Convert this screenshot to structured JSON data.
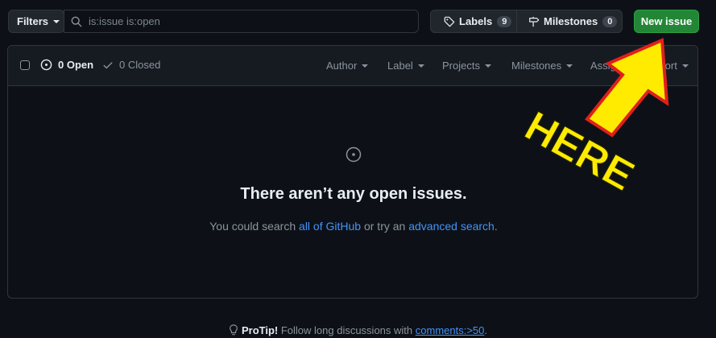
{
  "toolbar": {
    "filters_label": "Filters",
    "search_value": "is:issue is:open",
    "labels_label": "Labels",
    "labels_count": "9",
    "milestones_label": "Milestones",
    "milestones_count": "0",
    "new_issue_label": "New issue"
  },
  "list_header": {
    "open_label": "0 Open",
    "closed_label": "0 Closed",
    "filters": [
      "Author",
      "Label",
      "Projects",
      "Milestones",
      "Assignee",
      "Sort"
    ]
  },
  "empty_state": {
    "title": "There aren’t any open issues.",
    "desc_prefix": "You could search ",
    "link_all": "all of GitHub",
    "desc_middle": " or try an ",
    "link_advanced": "advanced search",
    "desc_suffix": "."
  },
  "protip": {
    "label": "ProTip!",
    "text": " Follow long discussions with ",
    "link": "comments:>50",
    "suffix": "."
  },
  "annotation": {
    "text": "HERE",
    "color": "#ffeb00",
    "outline_color": "#e0201b"
  },
  "colors": {
    "background": "#0d1117",
    "accent_green": "#238636",
    "link": "#4493f8"
  }
}
